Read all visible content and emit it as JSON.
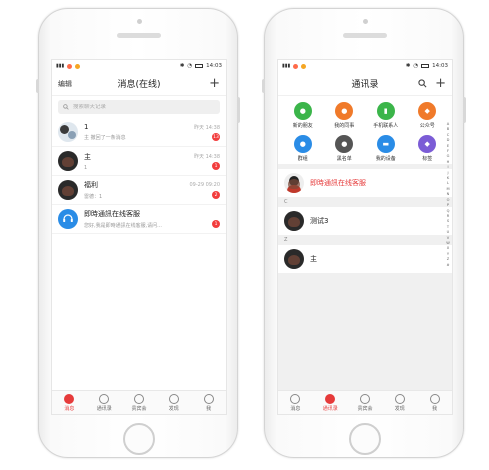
{
  "colors": {
    "accent": "#e63b3b",
    "badge": "#f23d3d",
    "service_blue": "#2a8ce6"
  },
  "status": {
    "time": "14:03"
  },
  "messages": {
    "nav_left": "编辑",
    "title": "消息(在线)",
    "search_placeholder": "搜索聊天记录",
    "conversations": [
      {
        "name": "1",
        "msg": "主 撤回了一条消息",
        "time": "昨天 14:38",
        "badge": "13",
        "avatar": "group"
      },
      {
        "name": "主",
        "msg": "1",
        "time": "昨天 14:38",
        "badge": "1",
        "avatar": "dark"
      },
      {
        "name": "福利",
        "msg": "雷德：1",
        "time": "09-29 09:20",
        "badge": "2",
        "avatar": "dark"
      },
      {
        "name": "即時通訊在线客服",
        "msg": "您好,我是即時通訊在线客服,请问...",
        "time": "",
        "badge": "1",
        "avatar": "service"
      }
    ]
  },
  "contacts": {
    "title": "通讯录",
    "grid": [
      {
        "label": "新的朋友",
        "color": "#3bb54a",
        "icon": "user-plus-icon"
      },
      {
        "label": "我的同事",
        "color": "#f07a2a",
        "icon": "colleague-icon"
      },
      {
        "label": "手机联系人",
        "color": "#3bb54a",
        "icon": "phone-icon"
      },
      {
        "label": "公众号",
        "color": "#f07a2a",
        "icon": "official-account-icon"
      },
      {
        "label": "群组",
        "color": "#2a8ce6",
        "icon": "group-icon"
      },
      {
        "label": "黑名单",
        "color": "#555555",
        "icon": "blacklist-icon"
      },
      {
        "label": "我的设备",
        "color": "#2a8ce6",
        "icon": "device-icon"
      },
      {
        "label": "标签",
        "color": "#7b5cd6",
        "icon": "tag-icon"
      }
    ],
    "service_name": "即時通訊在线客服",
    "sections": [
      {
        "letter": "C",
        "name": "测试3"
      },
      {
        "letter": "Z",
        "name": "主"
      }
    ],
    "index_letters": [
      "A",
      "B",
      "C",
      "D",
      "E",
      "F",
      "G",
      "H",
      "I",
      "J",
      "K",
      "L",
      "M",
      "N",
      "O",
      "P",
      "Q",
      "R",
      "S",
      "T",
      "U",
      "V",
      "W",
      "X",
      "Y",
      "Z",
      "#"
    ]
  },
  "tabs": [
    {
      "label": "消息",
      "icon": "message-icon"
    },
    {
      "label": "通讯录",
      "icon": "contacts-icon"
    },
    {
      "label": "贵宾会",
      "icon": "globe-icon"
    },
    {
      "label": "发现",
      "icon": "compass-icon"
    },
    {
      "label": "我",
      "icon": "profile-icon"
    }
  ]
}
